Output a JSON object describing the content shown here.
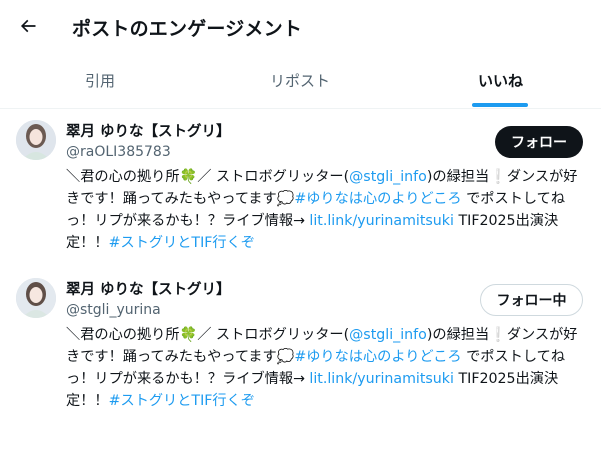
{
  "header": {
    "title": "ポストのエンゲージメント",
    "back_icon": "arrow-left-icon"
  },
  "tabs": [
    {
      "label": "引用",
      "active": false
    },
    {
      "label": "リポスト",
      "active": false
    },
    {
      "label": "いいね",
      "active": true
    }
  ],
  "colors": {
    "accent": "#1d9bf0",
    "text": "#0f1419",
    "muted": "#536471"
  },
  "users": [
    {
      "name": "翠月 ゆりな【ストグリ】",
      "handle": "@raOLI385783",
      "follow_label": "フォロー",
      "follow_state": "not-following",
      "bio": {
        "p1": "＼君の心の拠り所",
        "clover": "🍀",
        "p2": "／ ストロボグリッター(",
        "mention": "@stgli_info",
        "p3": ")の緑担当",
        "excl": "❕",
        "p4": "ダンスが好きです！踊ってみたもやってます",
        "bubble": "💭",
        "hashtag1": "#ゆりなは心のよりどころ",
        "p5": " でポストしてねっ！リプが来るかも！？ライブ情報→ ",
        "link": "lit.link/yurinamitsuki",
        "p6": " TIF2025出演決定！！",
        "hashtag2": "#ストグリとTIF行くぞ"
      }
    },
    {
      "name": "翠月 ゆりな【ストグリ】",
      "handle": "@stgli_yurina",
      "follow_label": "フォロー中",
      "follow_state": "following",
      "bio": {
        "p1": "＼君の心の拠り所",
        "clover": "🍀",
        "p2": "／ ストロボグリッター(",
        "mention": "@stgli_info",
        "p3": ")の緑担当",
        "excl": "❕",
        "p4": "ダンスが好きです！踊ってみたもやってます",
        "bubble": "💭",
        "hashtag1": "#ゆりなは心のよりどころ",
        "p5": " でポストしてねっ！リプが来るかも！？ライブ情報→ ",
        "link": "lit.link/yurinamitsuki",
        "p6": " TIF2025出演決定！！",
        "hashtag2": "#ストグリとTIF行くぞ"
      }
    }
  ]
}
